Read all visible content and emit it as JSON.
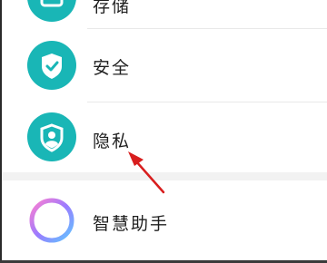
{
  "settings": {
    "items": [
      {
        "label": "存储",
        "icon": "storage-icon",
        "color": "#19b6b6"
      },
      {
        "label": "安全",
        "icon": "shield-check-icon",
        "color": "#19b6b6"
      },
      {
        "label": "隐私",
        "icon": "privacy-shield-user-icon",
        "color": "#19b6b6"
      },
      {
        "label": "智慧助手",
        "icon": "smart-assistant-ring-icon",
        "color": "#9b7bff"
      }
    ]
  },
  "annotation": {
    "arrow_color": "#d81e1e"
  }
}
